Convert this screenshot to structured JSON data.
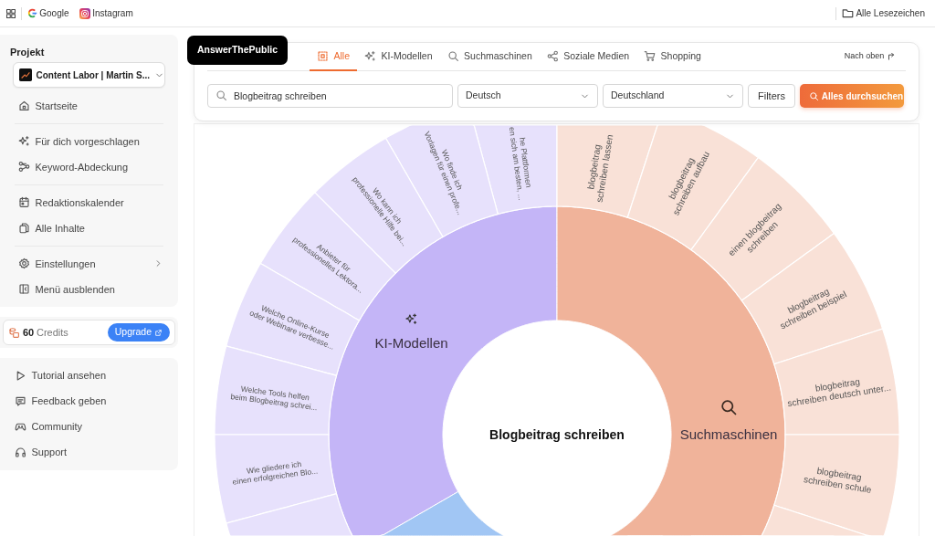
{
  "bookmarks_bar": {
    "items": [
      {
        "label": "Google"
      },
      {
        "label": "Instagram"
      }
    ],
    "all_bookmarks": "Alle Lesezeichen"
  },
  "sidebar": {
    "project_label": "Projekt",
    "project": "Content Labor | Martin S...",
    "groups": [
      [
        {
          "label": "Startseite",
          "has_submenu": false
        }
      ],
      [
        {
          "label": "Für dich vorgeschlagen",
          "has_submenu": false
        },
        {
          "label": "Keyword-Abdeckung",
          "has_submenu": false
        }
      ],
      [
        {
          "label": "Redaktionskalender",
          "has_submenu": false
        },
        {
          "label": "Alle Inhalte",
          "has_submenu": false
        }
      ],
      [
        {
          "label": "Einstellungen",
          "has_submenu": true
        },
        {
          "label": "Menü ausblenden",
          "has_submenu": false
        }
      ]
    ],
    "credits": {
      "count": "60",
      "label": "Credits",
      "button": "Upgrade"
    },
    "help_items": [
      {
        "label": "Tutorial ansehen"
      },
      {
        "label": "Feedback geben"
      },
      {
        "label": "Community"
      },
      {
        "label": "Support"
      }
    ]
  },
  "brand_badge": "AnswerThePublic",
  "tabs": [
    {
      "label": "Alle",
      "selected": true
    },
    {
      "label": "KI-Modellen",
      "selected": false
    },
    {
      "label": "Suchmaschinen",
      "selected": false
    },
    {
      "label": "Soziale Medien",
      "selected": false
    },
    {
      "label": "Shopping",
      "selected": false
    }
  ],
  "back_to_top": "Nach oben",
  "search": {
    "value": "Blogbeitrag schreiben",
    "language": "Deutsch",
    "country": "Deutschland",
    "filters_button": "Filters",
    "search_button": "Alles durchsuchen"
  },
  "sunburst": {
    "center": "Blogbeitrag schreiben",
    "categories": [
      {
        "label": "KI-Modellen",
        "color": "#c4b5f7",
        "items": [
          {
            "lines": [
              "he Plattformen",
              "en sich am besten, ..."
            ]
          },
          {
            "lines": [
              "Wo finde ich",
              "Vorlagen für einen profe..."
            ]
          },
          {
            "lines": [
              "Wo kann ich",
              "professionelle Hilfe bei..."
            ]
          },
          {
            "lines": [
              "Anbieter für",
              "professionelles Lektora..."
            ]
          },
          {
            "lines": [
              "Welche Online-Kurse",
              "oder Webinare verbesse..."
            ]
          },
          {
            "lines": [
              "Welche Tools helfen",
              "beim Blogbeitrag schrei..."
            ]
          },
          {
            "lines": [
              "Wie gliedere ich",
              "einen erfolgreichen Blo..."
            ]
          }
        ]
      },
      {
        "label": "Suchmaschinen",
        "color": "#f0b39a",
        "items": [
          {
            "lines": [
              "blogbeitrag",
              "schreiben lassen"
            ]
          },
          {
            "lines": [
              "blogbeitrag",
              "schreiben aufbau"
            ]
          },
          {
            "lines": [
              "einen blogbeitrag",
              "schreiben"
            ]
          },
          {
            "lines": [
              "blogbeitrag",
              "schreiben beispiel"
            ]
          },
          {
            "lines": [
              "blogbeitrag",
              "schreiben deutsch unter..."
            ]
          },
          {
            "lines": [
              "blogbeitrag",
              "schreiben schule"
            ]
          }
        ]
      },
      {
        "color": "#a1c6f4"
      }
    ]
  }
}
